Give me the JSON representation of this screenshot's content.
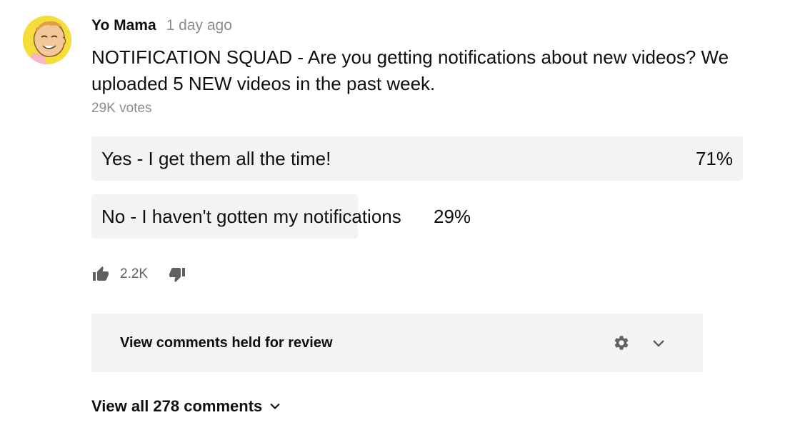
{
  "post": {
    "author": "Yo Mama",
    "time": "1 day ago",
    "text": "NOTIFICATION SQUAD - Are you getting notifications about new videos? We uploaded 5 NEW videos in the past week.",
    "votes": "29K votes"
  },
  "poll": {
    "options": [
      {
        "label": "Yes - I get them all the time!",
        "percent_text": "71%",
        "percent": 71
      },
      {
        "label": "No - I haven't gotten my notifications",
        "percent_text": "29%",
        "percent": 29
      }
    ]
  },
  "actions": {
    "like_count": "2.2K",
    "icons": {
      "like": "thumbs-up-icon",
      "dislike": "thumbs-down-icon"
    }
  },
  "held": {
    "text": "View comments held for review",
    "icons": {
      "settings": "gear-icon",
      "expand": "chevron-down-icon"
    }
  },
  "comments": {
    "view_all": "View all 278 comments"
  },
  "colors": {
    "poll_fill": "#f3f3f3",
    "muted_text": "#8c8c8c",
    "avatar_bg": "#f5dd3a"
  }
}
